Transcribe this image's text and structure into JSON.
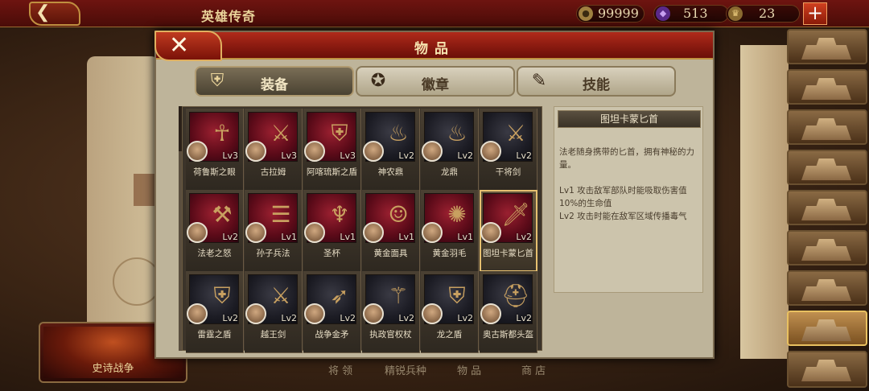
{
  "topbar": {
    "back_icon": "back-arrow-icon",
    "title": "英雄传奇",
    "coins": "99999",
    "gems": "513",
    "crowns": "23",
    "plus_label": "+"
  },
  "dialog": {
    "title": "物品",
    "close_label": "✕",
    "tabs": [
      {
        "label": "装备",
        "icon": "armor-icon",
        "active": true
      },
      {
        "label": "徽章",
        "icon": "badge-icon",
        "active": false
      },
      {
        "label": "技能",
        "icon": "scroll-icon",
        "active": false
      }
    ],
    "items": [
      {
        "name": "荷鲁斯之眼",
        "lv": "Lv3",
        "glyph": "☥"
      },
      {
        "name": "古拉姆",
        "lv": "Lv3",
        "glyph": "⚔"
      },
      {
        "name": "阿喀琉斯之盾",
        "lv": "Lv3",
        "glyph": "⛨"
      },
      {
        "name": "神农鼎",
        "lv": "Lv2",
        "glyph": "♨"
      },
      {
        "name": "龙鼎",
        "lv": "Lv2",
        "glyph": "♨"
      },
      {
        "name": "干将剑",
        "lv": "Lv2",
        "glyph": "⚔"
      },
      {
        "name": "法老之怒",
        "lv": "Lv2",
        "glyph": "⚒"
      },
      {
        "name": "孙子兵法",
        "lv": "Lv1",
        "glyph": "☰"
      },
      {
        "name": "圣杯",
        "lv": "Lv1",
        "glyph": "♆"
      },
      {
        "name": "黄金面具",
        "lv": "Lv1",
        "glyph": "☺"
      },
      {
        "name": "黄金羽毛",
        "lv": "Lv1",
        "glyph": "✺"
      },
      {
        "name": "图坦卡蒙匕首",
        "lv": "Lv2",
        "glyph": "🗡"
      },
      {
        "name": "雷霆之盾",
        "lv": "Lv2",
        "glyph": "⛨"
      },
      {
        "name": "越王剑",
        "lv": "Lv2",
        "glyph": "⚔"
      },
      {
        "name": "战争金矛",
        "lv": "Lv2",
        "glyph": "➶"
      },
      {
        "name": "执政官权杖",
        "lv": "Lv2",
        "glyph": "⚚"
      },
      {
        "name": "龙之盾",
        "lv": "Lv2",
        "glyph": "⛨"
      },
      {
        "name": "奥古斯都头盔",
        "lv": "Lv2",
        "glyph": "⛑"
      }
    ],
    "selected_index": 11,
    "detail": {
      "title": "图坦卡蒙匕首",
      "description": "法老随身携带的匕首，拥有神秘的力量。",
      "lv1": "Lv1  攻击敌军部队时能吸取伤害值10%的生命值",
      "lv2": "Lv2  攻击时能在敌军区域传播毒气"
    }
  },
  "background": {
    "epic_label": "史诗战争",
    "bottom_nav": [
      "将 领",
      "精锐兵种",
      "物 品",
      "商 店"
    ]
  },
  "colors": {
    "accent_red": "#8a1a10",
    "gold": "#e0b060",
    "parchment": "#beb49a"
  }
}
